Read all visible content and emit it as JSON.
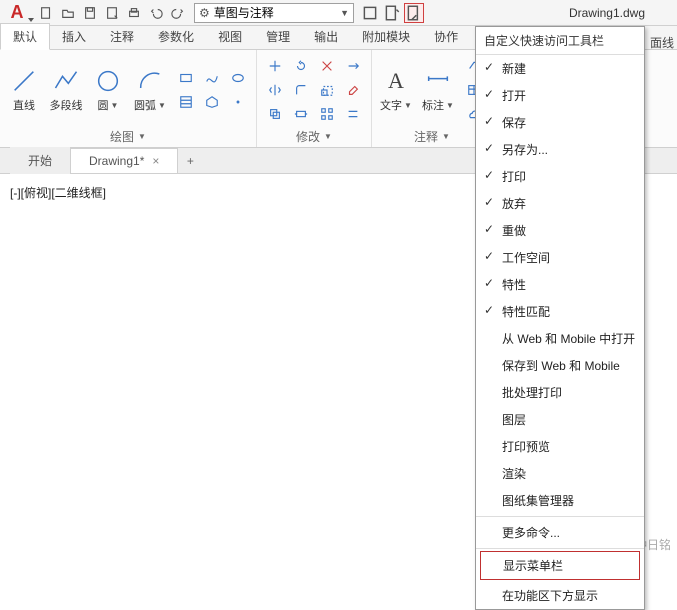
{
  "title": "Drawing1.dwg",
  "workspace": "草图与注释",
  "tabs": {
    "t0": "默认",
    "t1": "插入",
    "t2": "注释",
    "t3": "参数化",
    "t4": "视图",
    "t5": "管理",
    "t6": "输出",
    "t7": "附加模块",
    "t8": "协作"
  },
  "panels": {
    "draw": {
      "title": "绘图",
      "line": "直线",
      "pline": "多段线",
      "circle": "圆",
      "arc": "圆弧"
    },
    "modify": {
      "title": "修改"
    },
    "annot": {
      "title": "注释",
      "text": "文字",
      "dim": "标注"
    }
  },
  "docTabs": {
    "start": "开始",
    "d1": "Drawing1*"
  },
  "viewport": "[-][俯视][二维线框]",
  "rightStrip": "面线",
  "dropdown": {
    "title": "自定义快速访问工具栏",
    "items": {
      "new": "新建",
      "open": "打开",
      "save": "保存",
      "saveas": "另存为...",
      "print": "打印",
      "undo": "放弃",
      "redo": "重做",
      "ws": "工作空间",
      "prop": "特性",
      "match": "特性匹配",
      "webopen": "从 Web 和 Mobile 中打开",
      "websave": "保存到 Web 和 Mobile",
      "batch": "批处理打印",
      "layer": "图层",
      "preview": "打印预览",
      "render": "渲染",
      "sheet": "图纸集管理器",
      "more": "更多命令...",
      "menubar": "显示菜单栏",
      "below": "在功能区下方显示"
    }
  },
  "watermark": "头条号：CAD钟日铭"
}
